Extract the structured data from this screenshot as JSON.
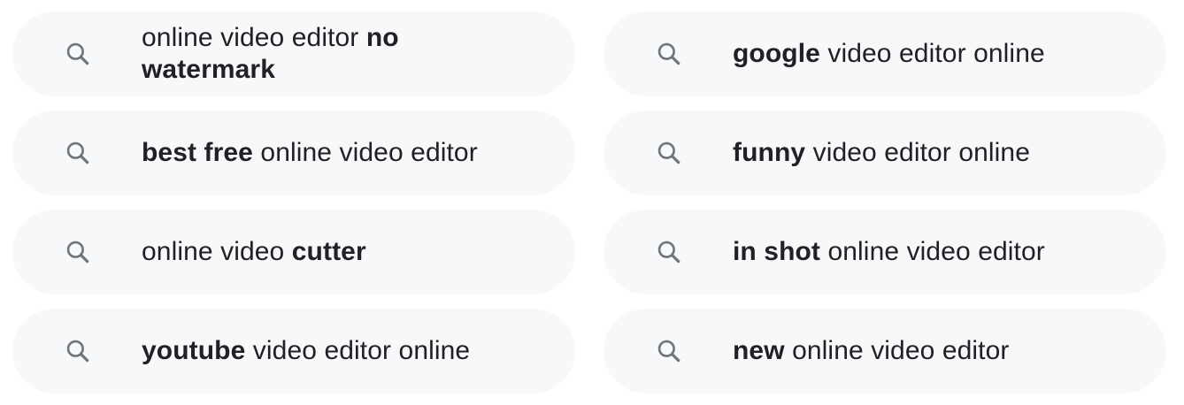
{
  "icon": "search-icon",
  "suggestions": [
    {
      "pre": "online video editor ",
      "bold": "no watermark",
      "post": ""
    },
    {
      "pre": "",
      "bold": "google",
      "post": " video editor online"
    },
    {
      "pre": "",
      "bold": "best free",
      "post": " online video editor"
    },
    {
      "pre": "",
      "bold": "funny",
      "post": " video editor online"
    },
    {
      "pre": "online video ",
      "bold": "cutter",
      "post": ""
    },
    {
      "pre": "",
      "bold": "in shot",
      "post": " online video editor"
    },
    {
      "pre": "",
      "bold": "youtube",
      "post": " video editor online"
    },
    {
      "pre": "",
      "bold": "new",
      "post": " online video editor"
    }
  ]
}
